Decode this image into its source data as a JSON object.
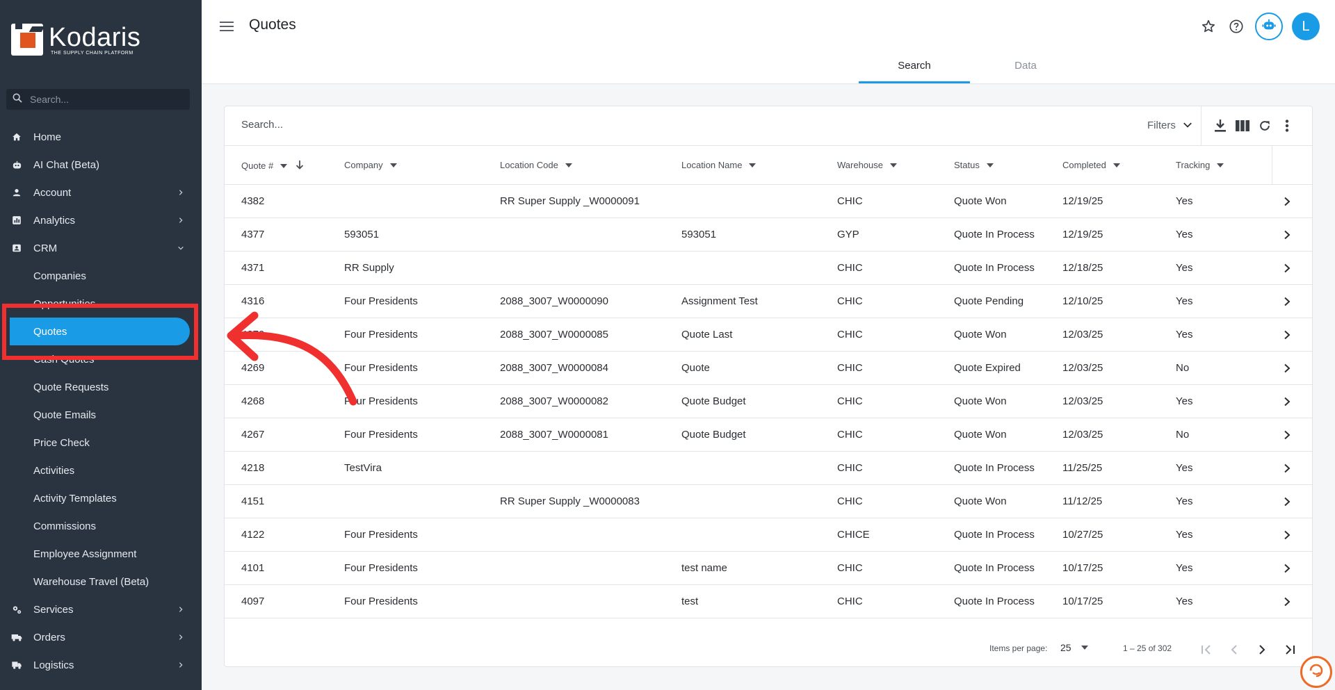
{
  "app": {
    "logo_name": "Kodaris",
    "logo_tagline": "THE SUPPLY CHAIN PLATFORM"
  },
  "sidebar": {
    "search_placeholder": "Search...",
    "items": [
      {
        "label": "Home",
        "icon": "home-icon"
      },
      {
        "label": "AI Chat (Beta)",
        "icon": "robot-icon"
      },
      {
        "label": "Account",
        "icon": "person-icon",
        "expandable": true
      },
      {
        "label": "Analytics",
        "icon": "analytics-icon",
        "expandable": true
      },
      {
        "label": "CRM",
        "icon": "contact-card-icon",
        "expandable": true,
        "expanded": true
      }
    ],
    "crm_sub": [
      "Companies",
      "Opportunities",
      "Quotes",
      "Cash Quotes",
      "Quote Requests",
      "Quote Emails",
      "Price Check",
      "Activities",
      "Activity Templates",
      "Commissions",
      "Employee Assignment",
      "Warehouse Travel (Beta)"
    ],
    "active_sub": "Quotes",
    "items_after": [
      {
        "label": "Services",
        "icon": "services-icon"
      },
      {
        "label": "Orders",
        "icon": "truck-icon"
      },
      {
        "label": "Logistics",
        "icon": "logistics-icon"
      }
    ]
  },
  "header": {
    "title": "Quotes",
    "avatar_initial": "L",
    "tabs": [
      {
        "label": "Search",
        "active": true
      },
      {
        "label": "Data",
        "active": false
      }
    ]
  },
  "table": {
    "search_placeholder": "Search...",
    "filters_label": "Filters",
    "columns": [
      "Quote #",
      "Company",
      "Location Code",
      "Location Name",
      "Warehouse",
      "Status",
      "Completed",
      "Tracking"
    ],
    "rows": [
      [
        "4382",
        "",
        "RR Super Supply _W0000091",
        "",
        "CHIC",
        "Quote Won",
        "12/19/25",
        "Yes"
      ],
      [
        "4377",
        "593051",
        "",
        "593051",
        "GYP",
        "Quote In Process",
        "12/19/25",
        "Yes"
      ],
      [
        "4371",
        "RR Supply",
        "",
        "",
        "CHIC",
        "Quote In Process",
        "12/18/25",
        "Yes"
      ],
      [
        "4316",
        "Four Presidents",
        "2088_3007_W0000090",
        "Assignment Test",
        "CHIC",
        "Quote Pending",
        "12/10/25",
        "Yes"
      ],
      [
        "4270",
        "Four Presidents",
        "2088_3007_W0000085",
        "Quote Last",
        "CHIC",
        "Quote Won",
        "12/03/25",
        "Yes"
      ],
      [
        "4269",
        "Four Presidents",
        "2088_3007_W0000084",
        "Quote",
        "CHIC",
        "Quote Expired",
        "12/03/25",
        "No"
      ],
      [
        "4268",
        "Four Presidents",
        "2088_3007_W0000082",
        "Quote Budget",
        "CHIC",
        "Quote Won",
        "12/03/25",
        "Yes"
      ],
      [
        "4267",
        "Four Presidents",
        "2088_3007_W0000081",
        "Quote Budget",
        "CHIC",
        "Quote Won",
        "12/03/25",
        "No"
      ],
      [
        "4218",
        "TestVira",
        "",
        "",
        "CHIC",
        "Quote In Process",
        "11/25/25",
        "Yes"
      ],
      [
        "4151",
        "",
        "RR Super Supply _W0000083",
        "",
        "CHIC",
        "Quote Won",
        "11/12/25",
        "Yes"
      ],
      [
        "4122",
        "Four Presidents",
        "",
        "",
        "CHICE",
        "Quote In Process",
        "10/27/25",
        "Yes"
      ],
      [
        "4101",
        "Four Presidents",
        "",
        "test name",
        "CHIC",
        "Quote In Process",
        "10/17/25",
        "Yes"
      ],
      [
        "4097",
        "Four Presidents",
        "",
        "test",
        "CHIC",
        "Quote In Process",
        "10/17/25",
        "Yes"
      ]
    ],
    "paginator": {
      "items_per_page_label": "Items per page:",
      "items_per_page": "25",
      "range_label": "1 – 25 of 302"
    }
  },
  "colors": {
    "sidebar_bg": "#2a3441",
    "accent": "#1a9be6",
    "highlight": "#f0302e",
    "brand_orange": "#e2541f"
  }
}
